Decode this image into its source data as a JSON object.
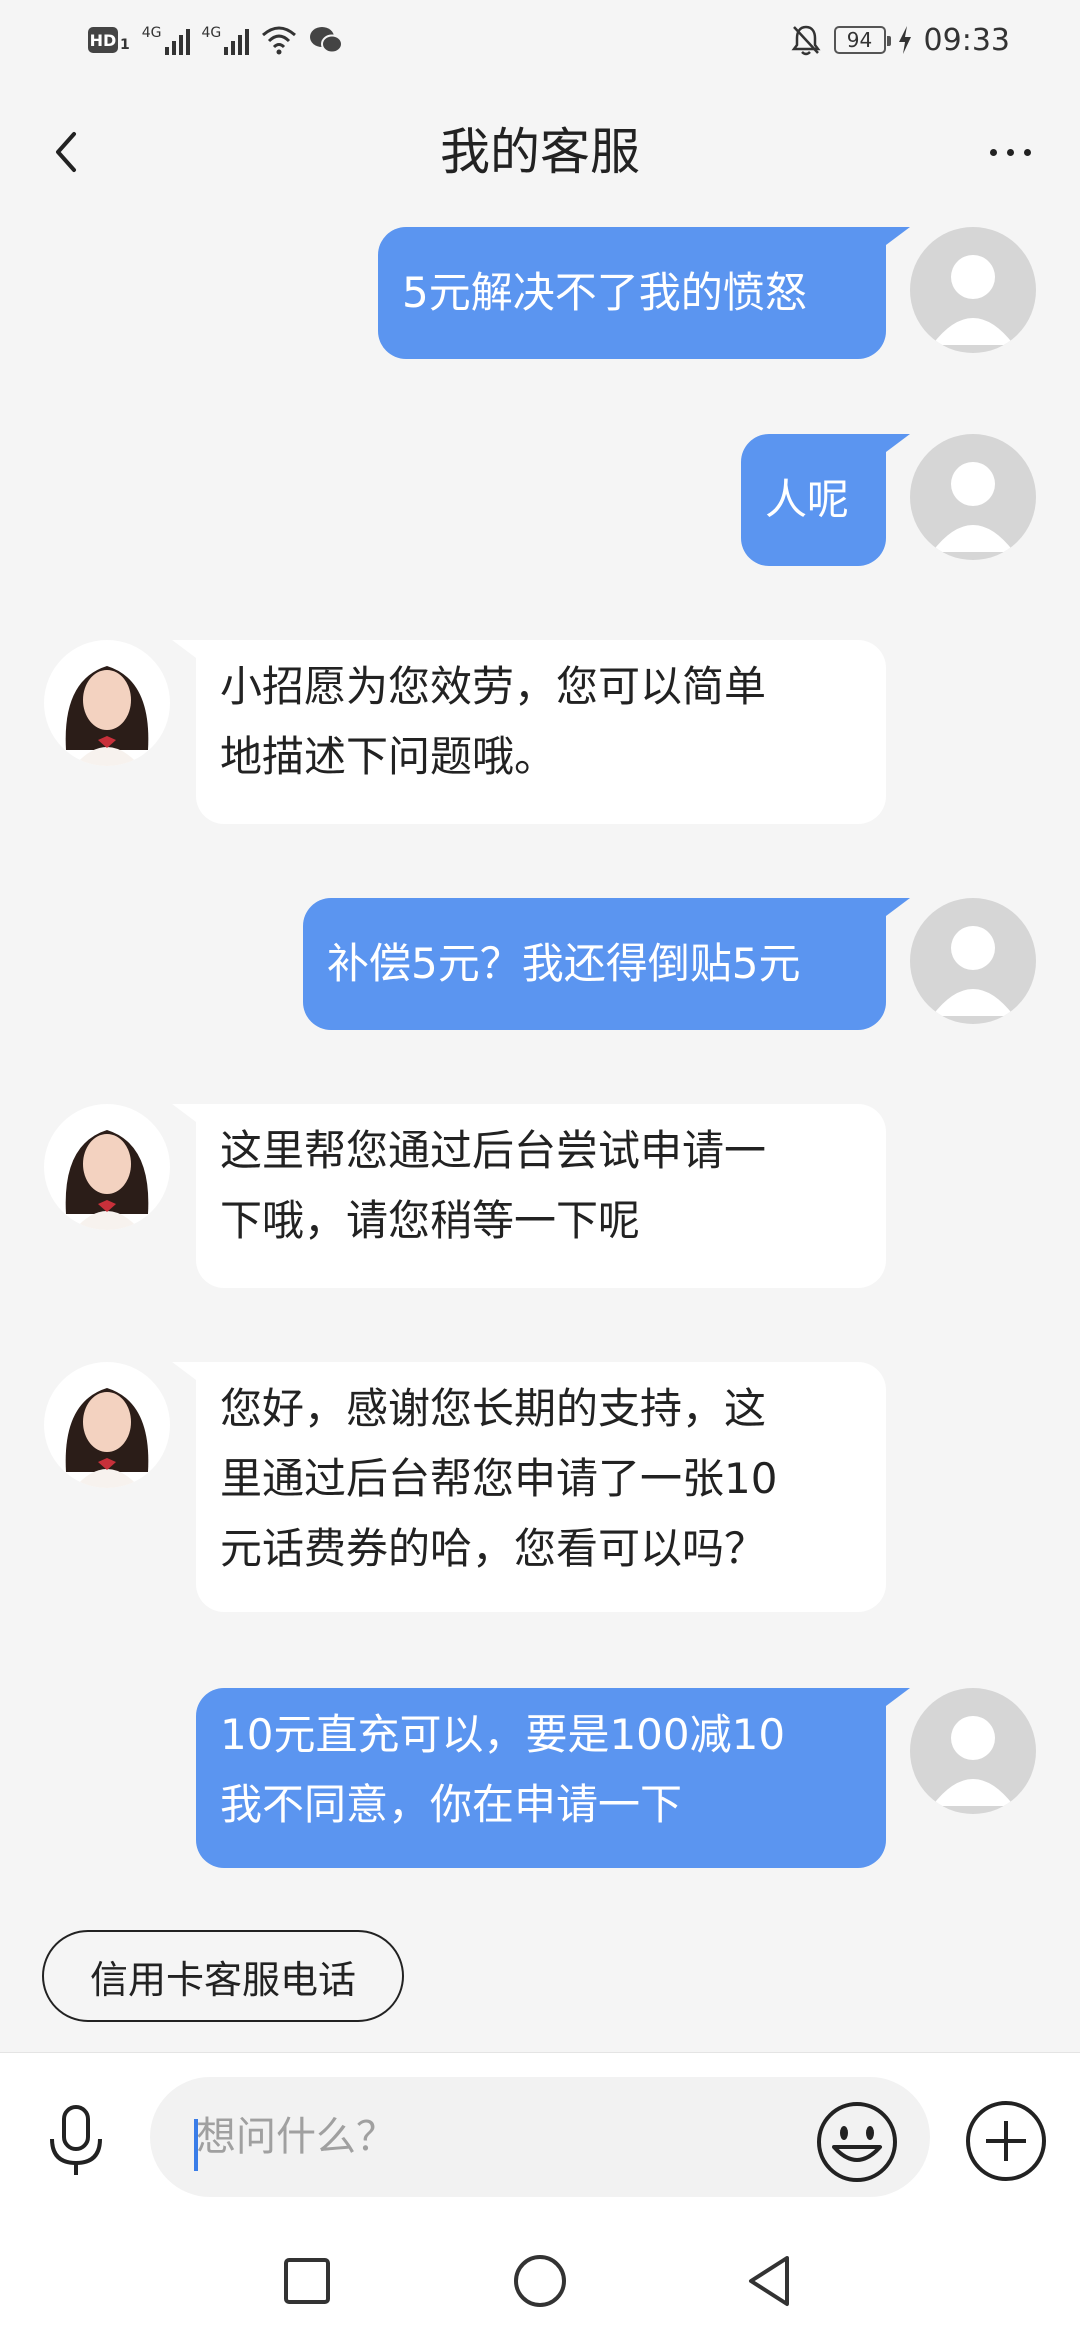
{
  "status_bar": {
    "hd": "HD",
    "sim_index": "1",
    "network_1": "4G",
    "network_2": "4G",
    "battery": "94",
    "time": "09:33"
  },
  "header": {
    "title": "我的客服",
    "back_icon": "chevron-left-icon",
    "more_icon": "more-horizontal-icon"
  },
  "messages": [
    {
      "from": "user",
      "text": "5元解决不了我的愤怒"
    },
    {
      "from": "user",
      "text": "人呢"
    },
    {
      "from": "agent",
      "lines": [
        "小招愿为您效劳，您可以简单",
        "地描述下问题哦。"
      ]
    },
    {
      "from": "user",
      "text": "补偿5元？我还得倒贴5元"
    },
    {
      "from": "agent",
      "lines": [
        "这里帮您通过后台尝试申请一",
        "下哦，请您稍等一下呢"
      ]
    },
    {
      "from": "agent",
      "lines": [
        "您好，感谢您长期的支持，这",
        "里通过后台帮您申请了一张10",
        "元话费券的哈，您看可以吗？"
      ]
    },
    {
      "from": "user",
      "lines": [
        "10元直充可以，要是100减10",
        "我不同意，你在申请一下"
      ]
    }
  ],
  "quick_reply": {
    "label": "信用卡客服电话"
  },
  "input_bar": {
    "placeholder": "想问什么？",
    "mic_icon": "microphone-icon",
    "emoji_icon": "smiley-icon",
    "plus_icon": "plus-circle-icon"
  },
  "nav_bar": {
    "icons": [
      "square-recents-icon",
      "circle-home-icon",
      "triangle-back-icon"
    ]
  },
  "colors": {
    "user_bubble": "#5b95f0",
    "agent_bubble": "#ffffff",
    "background": "#f5f5f5",
    "caret": "#3a7de8"
  }
}
